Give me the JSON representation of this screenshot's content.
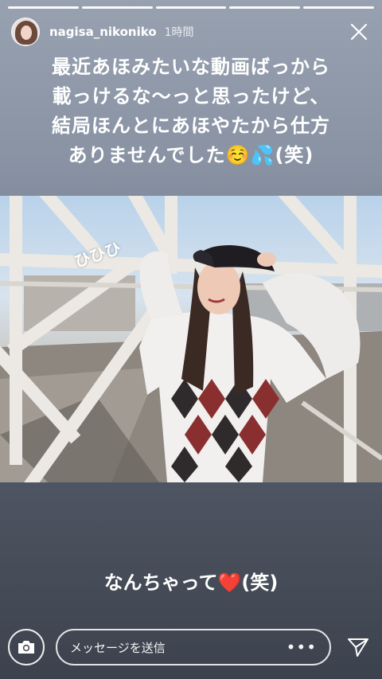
{
  "story": {
    "progress_segments": 5,
    "username": "nagisa_nikoniko",
    "time_ago": "1時間",
    "caption_lines": [
      "最近あほみたいな動画ばっから",
      "載っけるな〜っと思ったけど、",
      "結局ほんとにあほやたから仕方",
      "ありませんでした☺️💦(笑)"
    ],
    "sticker_text": "ひひひ",
    "bottom_text": "なんちゃって❤️(笑)"
  },
  "footer": {
    "message_placeholder": "メッセージを送信",
    "more_label": "•••"
  },
  "icons": {
    "close": "close-icon",
    "camera": "camera-icon",
    "send": "send-icon",
    "more": "more-dots-icon"
  }
}
